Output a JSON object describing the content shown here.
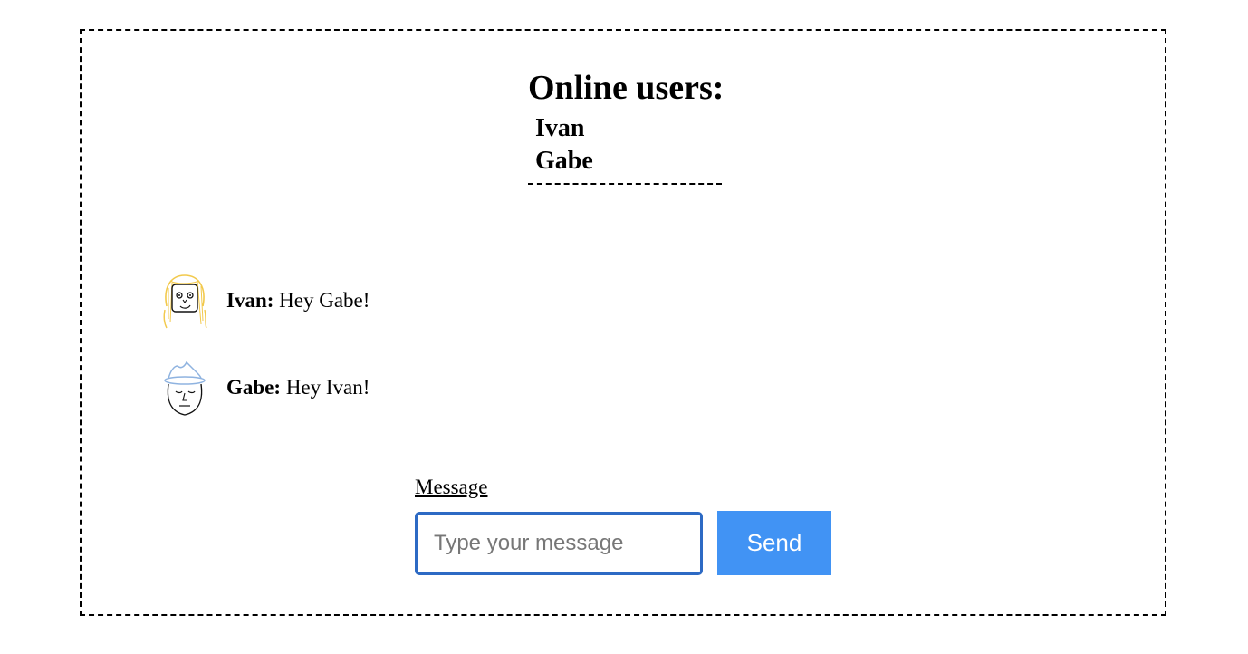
{
  "online": {
    "title": "Online users:",
    "users": [
      "Ivan",
      "Gabe"
    ]
  },
  "messages": [
    {
      "author": "Ivan:",
      "text": " Hey Gabe!",
      "avatar_icon": "blonde-person-avatar-icon"
    },
    {
      "author": "Gabe:",
      "text": " Hey Ivan!",
      "avatar_icon": "hat-person-avatar-icon"
    }
  ],
  "composer": {
    "label": "Message",
    "placeholder": "Type your message",
    "value": "",
    "send_label": "Send"
  },
  "colors": {
    "send_button": "#4193f4",
    "input_border": "#2d6ac4",
    "ivan_hair": "#f2c94c",
    "gabe_hat": "#8fb3e0"
  }
}
